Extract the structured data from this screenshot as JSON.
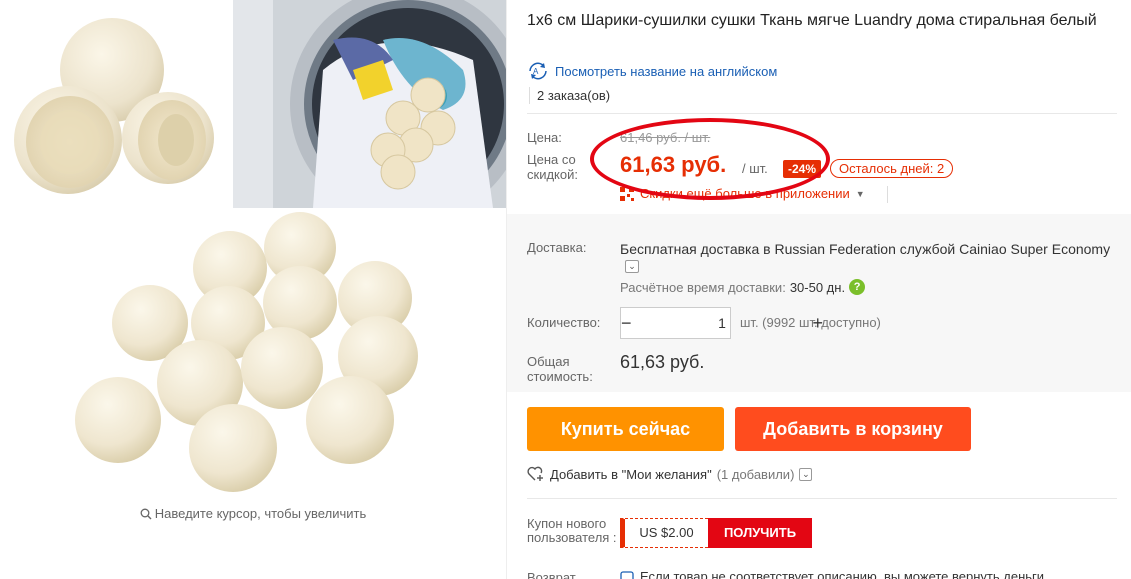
{
  "product": {
    "title": "1х6 см Шарики-сушилки сушки Ткань мягче Luandry дома стиральная белый",
    "translate_link": "Посмотреть название на английском",
    "orders": "2 заказа(ов)"
  },
  "price": {
    "label_price": "Цена:",
    "old_price": "61,46 руб. / шт.",
    "label_discount_price": "Цена со скидкой:",
    "new_price": "61,63 руб.",
    "per_unit": "/ шт.",
    "discount_badge": "-24%",
    "days_left": "Осталось дней: 2",
    "app_link": "Скидки ещё больше в приложении"
  },
  "shipping": {
    "label": "Доставка:",
    "text": "Бесплатная доставка в Russian Federation службой Cainiao Super Economy",
    "eta_label": "Расчётное время доставки:",
    "eta_value": "30-50 дн."
  },
  "quantity": {
    "label": "Количество:",
    "minus": "−",
    "value": "1",
    "plus": "+",
    "available": "шт. (9992 шт. доступно)"
  },
  "total": {
    "label": "Общая стоимость:",
    "value": "61,63 руб."
  },
  "actions": {
    "buy_now": "Купить сейчас",
    "add_to_cart": "Добавить в корзину",
    "wishlist": "Добавить в \"Мои желания\"",
    "wishlist_count": "(1 добавили)"
  },
  "coupon": {
    "label": "Купон нового пользователя :",
    "value": "US $2.00",
    "get": "ПОЛУЧИТЬ"
  },
  "returns": {
    "label": "Возврат",
    "text": "Если товар не соответствует описанию, вы можете вернуть деньги"
  },
  "gallery": {
    "zoom_hint": "Наведите курсор, чтобы увеличить"
  },
  "colors": {
    "accent_red": "#e62e04",
    "buy_orange": "#ff9200",
    "cart_orange": "#ff4c1e",
    "link_blue": "#1a5fb4"
  }
}
